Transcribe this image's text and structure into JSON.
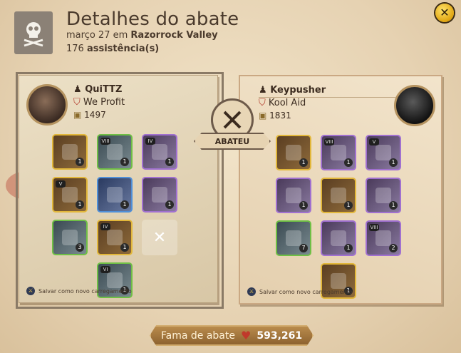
{
  "header": {
    "title": "Detalhes do abate",
    "date": "março 27 em",
    "location": "Razorrock Valley",
    "assist_count": "176",
    "assist_label": "assistência(s)"
  },
  "killer": {
    "name": "QuiTTZ",
    "guild": "We Profit",
    "ip": "1497",
    "equipment": [
      {
        "slot": "bag",
        "tier": "",
        "qty": "1",
        "rarity": "yellow"
      },
      {
        "slot": "head",
        "tier": "VIII",
        "qty": "1",
        "rarity": "green"
      },
      {
        "slot": "cape",
        "tier": "IV",
        "qty": "1",
        "rarity": "purple"
      },
      {
        "slot": "mainhand",
        "tier": "V",
        "qty": "1",
        "rarity": "yellow"
      },
      {
        "slot": "armor",
        "tier": "",
        "qty": "1",
        "rarity": "blue"
      },
      {
        "slot": "offhand",
        "tier": "",
        "qty": "1",
        "rarity": "purple"
      },
      {
        "slot": "potion",
        "tier": "",
        "qty": "3",
        "rarity": "green"
      },
      {
        "slot": "shoes",
        "tier": "IV",
        "qty": "1",
        "rarity": "yellow"
      },
      {
        "slot": "food",
        "tier": "",
        "qty": "",
        "rarity": "empty"
      },
      {
        "slot": "mount",
        "tier": "VI",
        "qty": "1",
        "rarity": "green"
      }
    ],
    "save_label": "Salvar como novo carregamento"
  },
  "victim": {
    "name": "Keypusher",
    "guild": "Kool Aid",
    "ip": "1831",
    "equipment": [
      {
        "slot": "bag",
        "tier": "",
        "qty": "1",
        "rarity": "yellow"
      },
      {
        "slot": "head",
        "tier": "VIII",
        "qty": "1",
        "rarity": "purple"
      },
      {
        "slot": "cape",
        "tier": "V",
        "qty": "1",
        "rarity": "purple"
      },
      {
        "slot": "mainhand",
        "tier": "",
        "qty": "1",
        "rarity": "purple"
      },
      {
        "slot": "armor",
        "tier": "",
        "qty": "1",
        "rarity": "yellow"
      },
      {
        "slot": "offhand",
        "tier": "",
        "qty": "1",
        "rarity": "purple"
      },
      {
        "slot": "potion",
        "tier": "",
        "qty": "7",
        "rarity": "green"
      },
      {
        "slot": "shoes",
        "tier": "",
        "qty": "1",
        "rarity": "purple"
      },
      {
        "slot": "food",
        "tier": "VIII",
        "qty": "2",
        "rarity": "purple"
      },
      {
        "slot": "mount",
        "tier": "",
        "qty": "1",
        "rarity": "yellow"
      }
    ],
    "save_label": "Salvar como novo carregamento"
  },
  "center": {
    "badge_label": "ABATEU"
  },
  "footer": {
    "fame_label": "Fama de abate",
    "fame_value": "593,261"
  },
  "icons": {
    "close": "close-icon",
    "skull": "skull-crossbones-icon",
    "swords": "crossed-swords-icon",
    "save": "save-loadout-icon",
    "fame": "fame-icon"
  }
}
